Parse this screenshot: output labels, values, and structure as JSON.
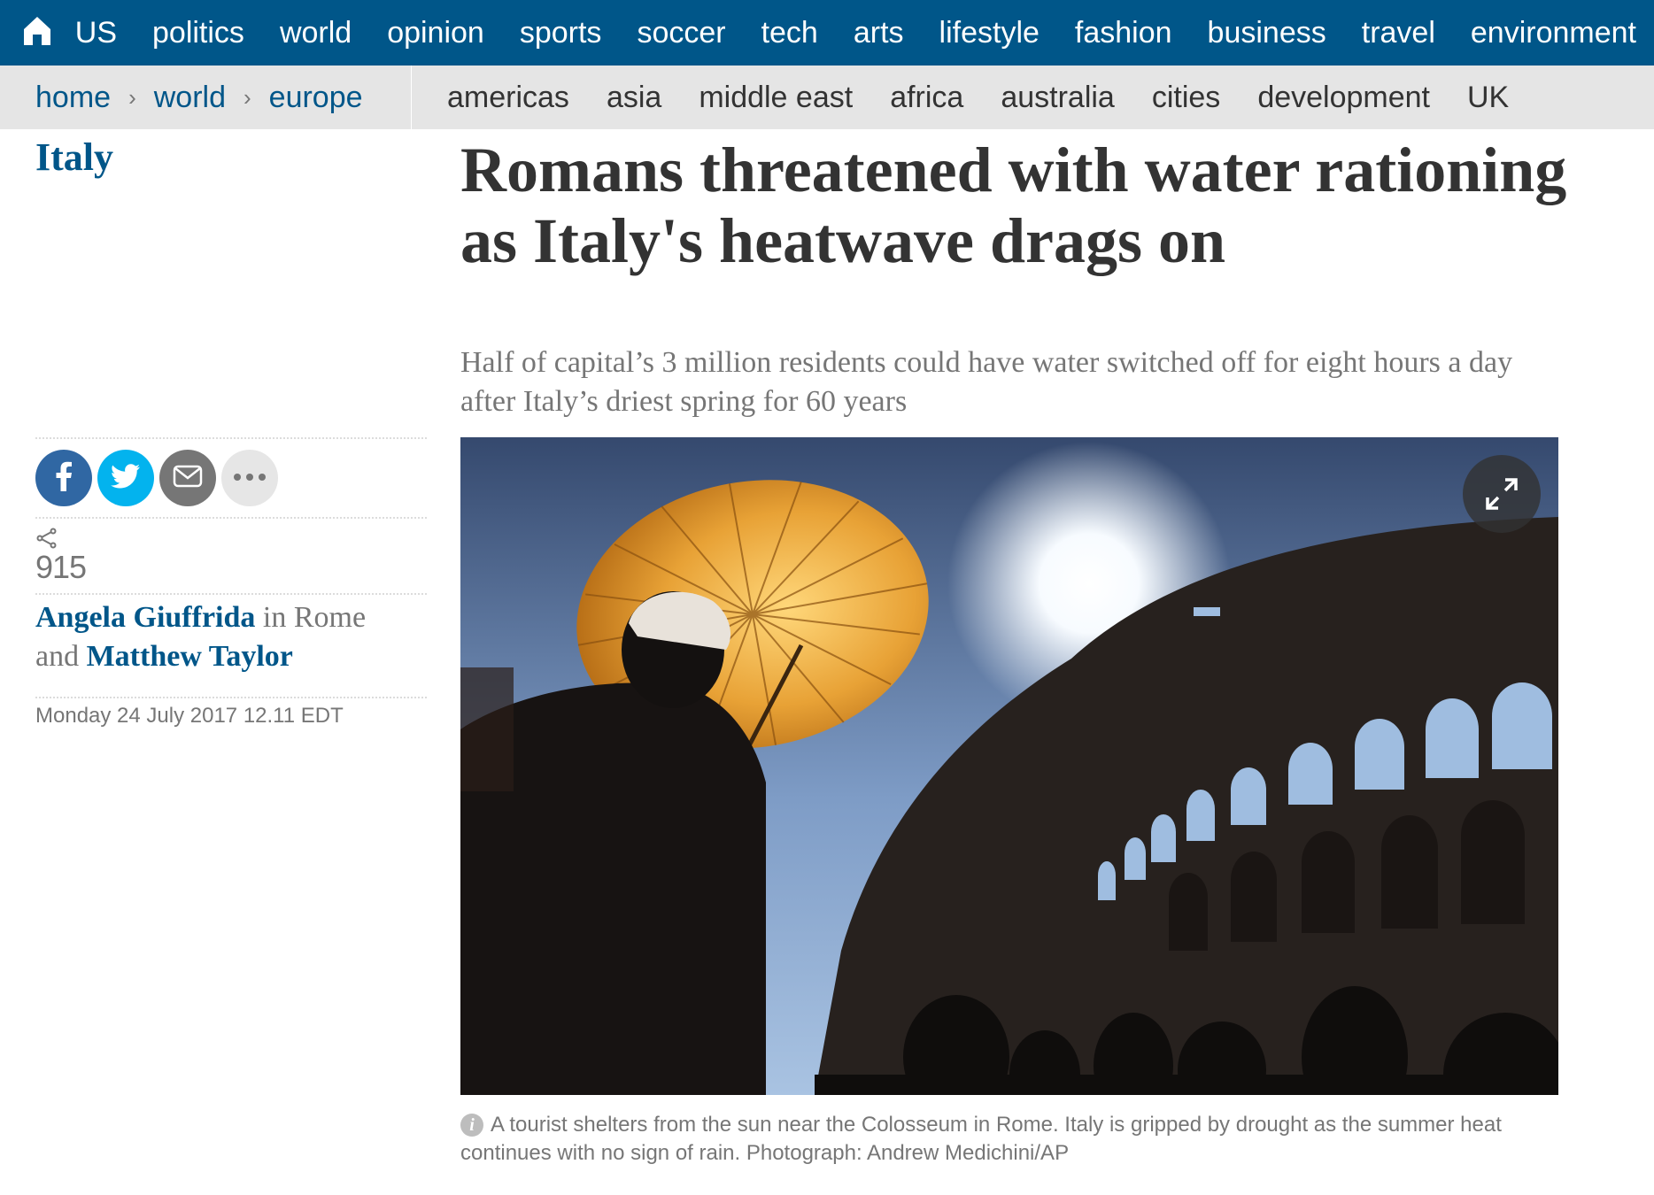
{
  "topnav": {
    "home_icon": "home-icon",
    "items": [
      "US",
      "politics",
      "world",
      "opinion",
      "sports",
      "soccer",
      "tech",
      "arts",
      "lifestyle",
      "fashion",
      "business",
      "travel",
      "environment"
    ]
  },
  "breadcrumb": {
    "items": [
      "home",
      "world",
      "europe"
    ],
    "separator": "›"
  },
  "subnav": {
    "items": [
      "americas",
      "asia",
      "middle east",
      "africa",
      "australia",
      "cities",
      "development",
      "UK"
    ]
  },
  "article": {
    "section": "Italy",
    "headline": "Romans threatened with water rationing as Italy's heatwave drags on",
    "standfirst": "Half of capital’s 3 million residents could have water switched off for eight hours a day after Italy’s driest spring for 60 years",
    "share_count": "915",
    "byline": {
      "author1": "Angela Giuffrida",
      "in": " in Rome",
      "and": "and ",
      "author2": "Matthew Taylor"
    },
    "date": "Monday 24 July 2017 12.11 EDT",
    "caption": "A tourist shelters from the sun near the Colosseum in Rome. Italy is gripped by drought as the summer heat continues with no sign of rain. Photograph: Andrew Medichini/AP"
  },
  "colors": {
    "brand_blue": "#005689",
    "subnav_bg": "#e5e5e5",
    "facebook": "#3067a3",
    "twitter": "#03b3ee",
    "email": "#767676"
  },
  "icons": {
    "share": [
      "facebook-icon",
      "twitter-icon",
      "email-icon",
      "more-icon"
    ],
    "expand": "expand-icon",
    "info": "info-icon"
  }
}
